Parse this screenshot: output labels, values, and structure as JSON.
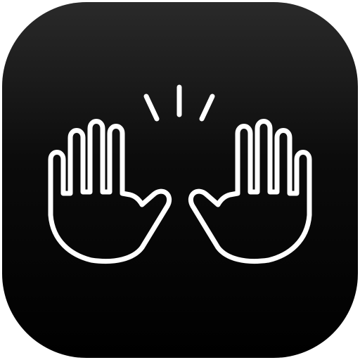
{
  "app_icon": {
    "icon": "raised-hands-icon",
    "background_top": "#2a2a2a",
    "background_bottom": "#000000",
    "glyph_color": "#ffffff"
  }
}
